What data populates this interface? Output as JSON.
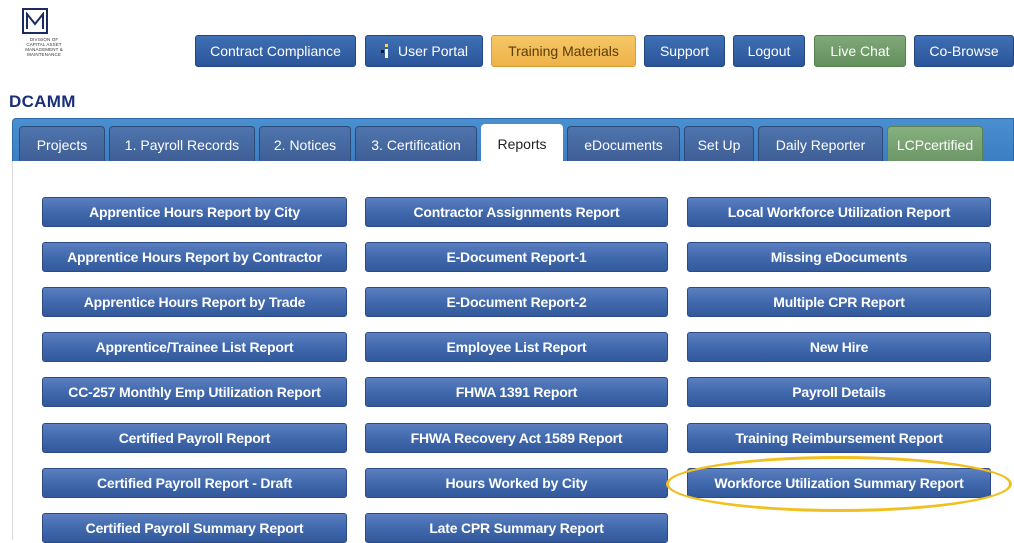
{
  "logo": {
    "small_text": "DIVISION OF\nCAPITAL ASSET\nMANAGEMENT &\nMAINTENANCE",
    "title": "DCAMM"
  },
  "topnav": [
    {
      "label": "Contract Compliance",
      "style": "blue"
    },
    {
      "label": "User Portal",
      "style": "blue",
      "icon": "info-icon"
    },
    {
      "label": "Training Materials",
      "style": "orange"
    },
    {
      "label": "Support",
      "style": "blue"
    },
    {
      "label": "Logout",
      "style": "blue"
    },
    {
      "label": "Live Chat",
      "style": "green"
    },
    {
      "label": "Co-Browse",
      "style": "blue"
    }
  ],
  "tabs": [
    {
      "label": "Projects"
    },
    {
      "label": "1. Payroll Records"
    },
    {
      "label": "2. Notices"
    },
    {
      "label": "3. Certification"
    },
    {
      "label": "Reports",
      "active": true
    },
    {
      "label": "eDocuments"
    },
    {
      "label": "Set Up"
    },
    {
      "label": "Daily Reporter"
    },
    {
      "label": "LCPcertified",
      "style": "green"
    }
  ],
  "reports": {
    "col1": [
      "Apprentice Hours Report by City",
      "Apprentice Hours Report by Contractor",
      "Apprentice Hours Report by Trade",
      "Apprentice/Trainee List Report",
      "CC-257 Monthly Emp Utilization Report",
      "Certified Payroll Report",
      "Certified Payroll Report - Draft",
      "Certified Payroll Summary Report"
    ],
    "col2": [
      "Contractor Assignments Report",
      "E-Document Report-1",
      "E-Document Report-2",
      "Employee List Report",
      "FHWA 1391 Report",
      "FHWA Recovery Act 1589 Report",
      "Hours Worked by City",
      "Late CPR Summary Report"
    ],
    "col3": [
      "Local Workforce Utilization Report",
      "Missing eDocuments",
      "Multiple CPR Report",
      "New Hire",
      "Payroll Details",
      "Training Reimbursement Report",
      "Workforce Utilization Summary Report"
    ]
  },
  "colors": {
    "button_blue": "#4169ad",
    "orange": "#eeb24a",
    "green": "#6d9667",
    "tabbar": "#3b7fc2",
    "highlight": "#f0c020",
    "title": "#1a2f7a"
  }
}
